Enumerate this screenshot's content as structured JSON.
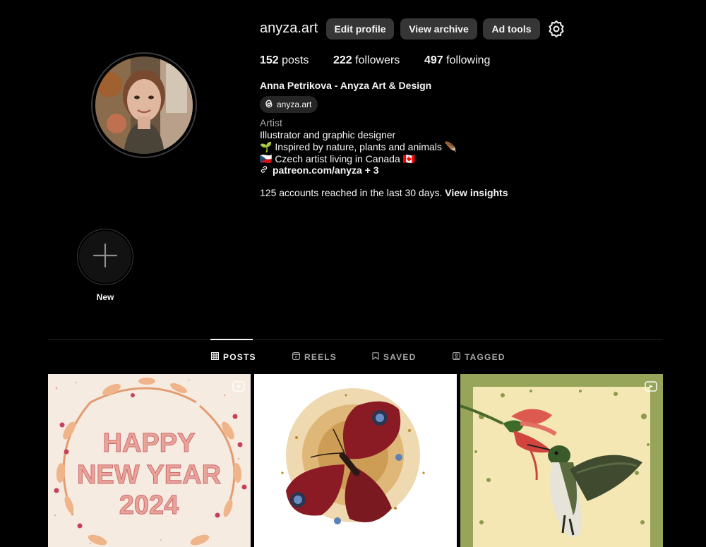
{
  "profile": {
    "username": "anyza.art",
    "full_name": "Anna Petrikova - Anyza Art & Design",
    "threads_handle": "anyza.art",
    "category": "Artist",
    "bio": [
      "Illustrator and graphic designer",
      "🌱 Inspired by nature, plants and animals 🪶",
      "🇨🇿 Czech artist living in Canada 🇨🇦"
    ],
    "link": "patreon.com/anyza + 3",
    "insights_text": "125 accounts reached in the last 30 days.",
    "insights_link": "View insights"
  },
  "actions": {
    "edit_profile": "Edit profile",
    "view_archive": "View archive",
    "ad_tools": "Ad tools"
  },
  "stats": {
    "posts_count": "152",
    "posts_label": "posts",
    "followers_count": "222",
    "followers_label": "followers",
    "following_count": "497",
    "following_label": "following"
  },
  "highlights": {
    "new_label": "New"
  },
  "tabs": [
    {
      "label": "POSTS",
      "icon": "grid-icon",
      "active": true
    },
    {
      "label": "REELS",
      "icon": "reels-icon",
      "active": false
    },
    {
      "label": "SAVED",
      "icon": "bookmark-icon",
      "active": false
    },
    {
      "label": "TAGGED",
      "icon": "tagged-icon",
      "active": false
    }
  ],
  "posts": [
    {
      "alt": "Happy New Year 2024 wreath illustration",
      "text_lines": [
        "HAPPY",
        "NEW YEAR",
        "2024"
      ],
      "is_reel": true
    },
    {
      "alt": "Peacock butterfly illustration",
      "is_reel": false
    },
    {
      "alt": "Hummingbird with red flower illustration",
      "is_reel": true
    }
  ],
  "colors": {
    "background": "#000000",
    "button_bg": "#363636",
    "muted_text": "#a8a8a8",
    "divider": "#262626"
  }
}
